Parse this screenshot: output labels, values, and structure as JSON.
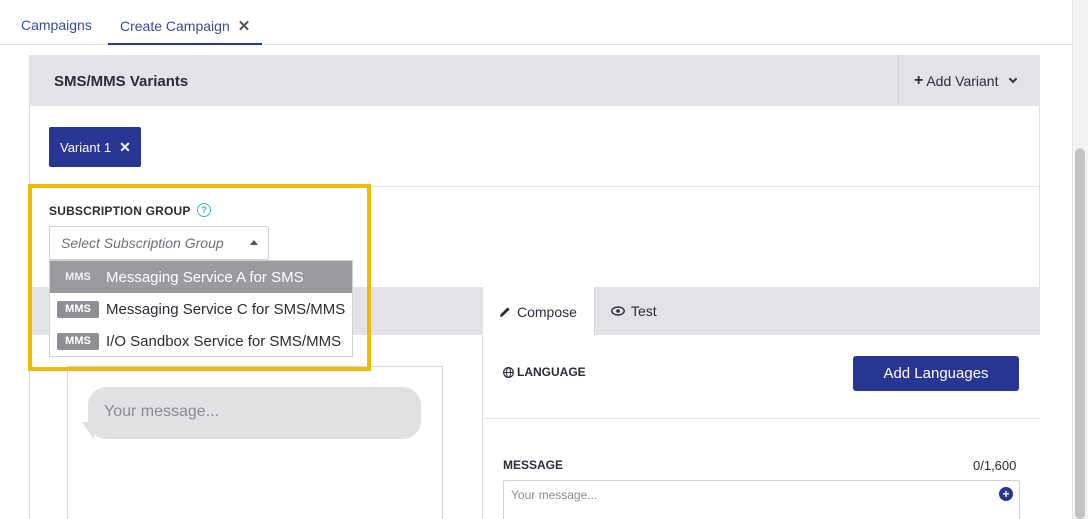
{
  "tabs": {
    "campaigns": "Campaigns",
    "create_campaign": "Create Campaign",
    "close_glyph": "✕"
  },
  "panel": {
    "title": "SMS/MMS Variants",
    "add_variant_label": "Add Variant",
    "add_variant_glyph": "+"
  },
  "variant": {
    "label": "Variant 1",
    "close_glyph": "✕"
  },
  "subscription": {
    "label": "SUBSCRIPTION GROUP",
    "help_glyph": "?",
    "placeholder": "Select Subscription Group",
    "options": [
      {
        "badge": "MMS",
        "label": "Messaging Service A for SMS",
        "highlighted": true
      },
      {
        "badge": "MMS",
        "label": "Messaging Service C for SMS/MMS",
        "highlighted": false
      },
      {
        "badge": "MMS",
        "label": "I/O Sandbox Service for SMS/MMS",
        "highlighted": false
      }
    ]
  },
  "preview": {
    "bubble_text": "Your message..."
  },
  "compose": {
    "tab_compose": "Compose",
    "tab_test": "Test",
    "language_label": "LANGUAGE",
    "add_languages_button": "Add Languages",
    "message_label": "MESSAGE",
    "message_count": "0/1,600",
    "message_placeholder": "Your message..."
  },
  "colors": {
    "brand": "#283592",
    "highlight_outline": "#f5b800",
    "header_bg": "#e3e3e7"
  },
  "icons": [
    "close-icon",
    "plus-icon",
    "chevron-down-icon",
    "help-icon",
    "caret-up-icon",
    "pencil-icon",
    "eye-icon",
    "globe-icon",
    "add-circle-icon"
  ]
}
